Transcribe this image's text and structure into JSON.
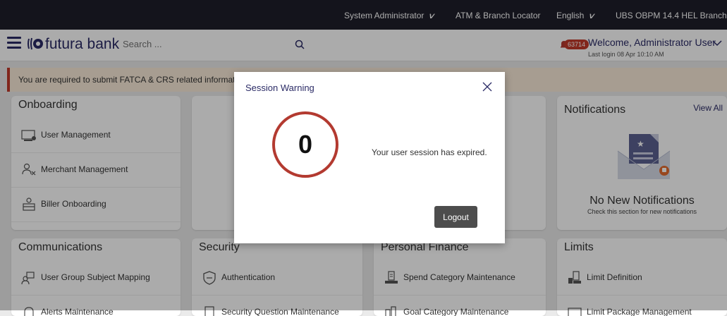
{
  "topbar": {
    "role": "System Administrator",
    "locator": "ATM & Branch Locator",
    "language": "English",
    "branch": "UBS OBPM 14.4 HEL Branch"
  },
  "header": {
    "brand": "futura bank",
    "search_placeholder": "Search ...",
    "notification_count": "63714",
    "welcome": "Welcome, Administrator User",
    "last_login": "Last login 08 Apr 10:10 AM"
  },
  "alert_banner": "You are required to submit FATCA & CRS related information",
  "onboarding": {
    "title": "Onboarding",
    "items": [
      {
        "label": "User Management",
        "icon": "user-management-icon"
      },
      {
        "label": "Merchant Management",
        "icon": "merchant-management-icon"
      },
      {
        "label": "Biller Onboarding",
        "icon": "biller-onboarding-icon"
      }
    ]
  },
  "notifications": {
    "title": "Notifications",
    "view_all": "View All",
    "empty_title": "No New Notifications",
    "empty_subtitle": "Check this section for new notifications"
  },
  "communications": {
    "title": "Communications",
    "items": [
      {
        "label": "User Group Subject Mapping"
      },
      {
        "label": "Alerts Maintenance"
      }
    ]
  },
  "security": {
    "title": "Security",
    "items": [
      {
        "label": "Authentication"
      },
      {
        "label": "Security Question Maintenance"
      }
    ]
  },
  "personal_finance": {
    "title": "Personal Finance",
    "items": [
      {
        "label": "Spend Category Maintenance"
      },
      {
        "label": "Goal Category Maintenance"
      }
    ]
  },
  "limits": {
    "title": "Limits",
    "items": [
      {
        "label": "Limit Definition"
      },
      {
        "label": "Limit Package Management"
      }
    ]
  },
  "modal": {
    "title": "Session Warning",
    "countdown": "0",
    "message": "Your user session has expired.",
    "logout_label": "Logout"
  },
  "colors": {
    "brand": "#2b2b66",
    "accent": "#b33a30",
    "topbar": "#1f1f2a",
    "alert_bg": "#faebd8"
  }
}
